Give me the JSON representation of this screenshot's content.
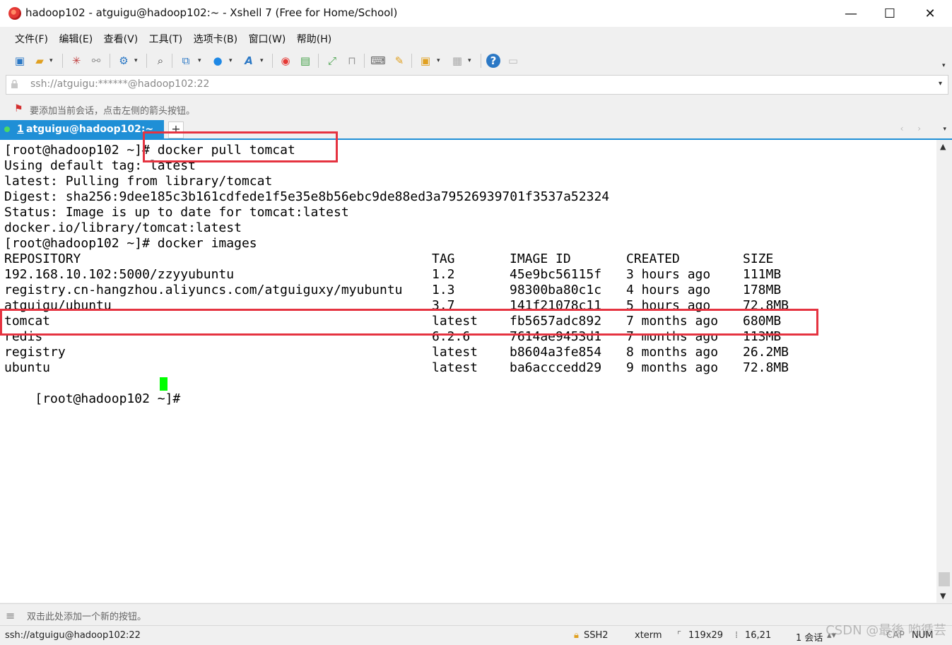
{
  "window": {
    "title": "hadoop102 - atguigu@hadoop102:~ - Xshell 7 (Free for Home/School)",
    "minimize": "—",
    "maximize": "☐",
    "close": "✕"
  },
  "menu": [
    "文件(F)",
    "编辑(E)",
    "查看(V)",
    "工具(T)",
    "选项卡(B)",
    "窗口(W)",
    "帮助(H)"
  ],
  "address": {
    "value": "ssh://atguigu:******@hadoop102:22",
    "caret": "▾"
  },
  "hint": {
    "flag": "⚑",
    "text": "要添加当前会话，点击左侧的箭头按钮。"
  },
  "tab": {
    "number": "1",
    "label": "atguigu@hadoop102:~",
    "add": "+",
    "nav": "‹ ›",
    "menu": "▾"
  },
  "terminal": {
    "lines": [
      "[root@hadoop102 ~]# docker pull tomcat",
      "Using default tag: latest",
      "latest: Pulling from library/tomcat",
      "Digest: sha256:9dee185c3b161cdfede1f5e35e8b56ebc9de88ed3a79526939701f3537a52324",
      "Status: Image is up to date for tomcat:latest",
      "docker.io/library/tomcat:latest",
      "[root@hadoop102 ~]# docker images"
    ],
    "table_headers": [
      "REPOSITORY",
      "TAG",
      "IMAGE ID",
      "CREATED",
      "SIZE"
    ],
    "table_rows": [
      [
        "192.168.10.102:5000/zzyyubuntu",
        "1.2",
        "45e9bc56115f",
        "3 hours ago",
        "111MB"
      ],
      [
        "registry.cn-hangzhou.aliyuncs.com/atguiguxy/myubuntu",
        "1.3",
        "98300ba80c1c",
        "4 hours ago",
        "178MB"
      ],
      [
        "atguigu/ubuntu",
        "3.7",
        "141f21078c11",
        "5 hours ago",
        "72.8MB"
      ],
      [
        "tomcat",
        "latest",
        "fb5657adc892",
        "7 months ago",
        "680MB"
      ],
      [
        "redis",
        "6.2.6",
        "7614ae9453d1",
        "7 months ago",
        "113MB"
      ],
      [
        "registry",
        "latest",
        "b8604a3fe854",
        "8 months ago",
        "26.2MB"
      ],
      [
        "ubuntu",
        "latest",
        "ba6acccedd29",
        "9 months ago",
        "72.8MB"
      ]
    ],
    "prompt": "[root@hadoop102 ~]#",
    "cursor_color": "#00ff00",
    "highlight_color": "#e53340"
  },
  "scrollbar": {
    "up": "▲",
    "down": "▼"
  },
  "quickbar": {
    "icon": "≡",
    "text": "双击此处添加一个新的按钮。"
  },
  "status": {
    "connection": "ssh://atguigu@hadoop102:22",
    "protocol": "SSH2",
    "terminal_type": "xterm",
    "size": "119x29",
    "position": "16,21",
    "sessions": "1 会话",
    "caps": "CAP",
    "num": "NUM",
    "watermark": "CSDN @最後 哟循芸"
  },
  "toolbar_icons": [
    "new-session-icon",
    "open-folder-icon",
    "reconnect-icon",
    "disconnect-icon",
    "properties-icon",
    "find-icon",
    "transfer-icon",
    "globe-icon",
    "font-icon",
    "xshell-icon",
    "xftp-icon",
    "fullscreen-icon",
    "lock-icon",
    "keyboard-icon",
    "script-icon",
    "add-tab-icon",
    "layout-icon",
    "help-icon",
    "chat-icon"
  ]
}
